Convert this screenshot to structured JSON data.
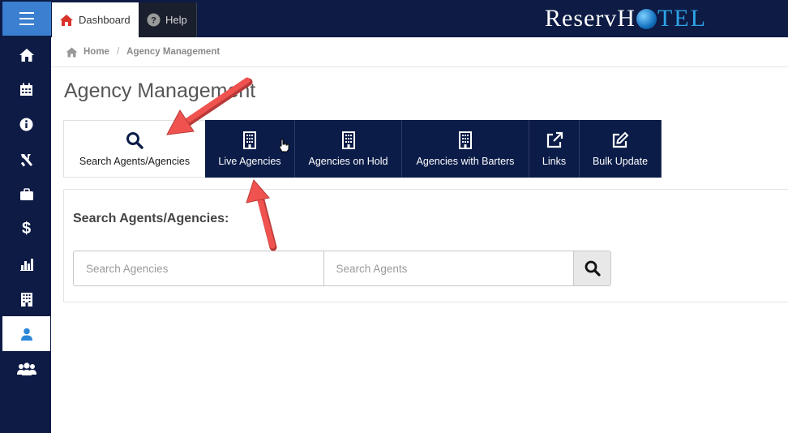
{
  "topbar": {
    "menu_icon": "hamburger-icon",
    "tabs": [
      {
        "label": "Dashboard",
        "icon": "home-icon"
      },
      {
        "label": "Help",
        "icon": "question-circle-icon"
      }
    ],
    "brand": {
      "part1": "ReservH",
      "part2": "TEL"
    }
  },
  "sidebar": {
    "items": [
      {
        "icon": "home-icon"
      },
      {
        "icon": "calendar-icon"
      },
      {
        "icon": "info-icon"
      },
      {
        "icon": "tools-icon"
      },
      {
        "icon": "briefcase-icon"
      },
      {
        "icon": "dollar-icon"
      },
      {
        "icon": "bar-chart-icon"
      },
      {
        "icon": "building-icon"
      },
      {
        "icon": "user-icon",
        "active": true
      },
      {
        "icon": "users-icon"
      }
    ]
  },
  "breadcrumb": {
    "home": "Home",
    "current": "Agency Management"
  },
  "page": {
    "title": "Agency Management"
  },
  "tabs": [
    {
      "label": "Search Agents/Agencies",
      "icon": "search-icon",
      "active": true
    },
    {
      "label": "Live Agencies",
      "icon": "building-icon"
    },
    {
      "label": "Agencies on Hold",
      "icon": "building-icon"
    },
    {
      "label": "Agencies with Barters",
      "icon": "building-icon"
    },
    {
      "label": "Links",
      "icon": "external-link-icon"
    },
    {
      "label": "Bulk Update",
      "icon": "edit-icon"
    }
  ],
  "search": {
    "title": "Search Agents/Agencies:",
    "agencies_placeholder": "Search Agencies",
    "agents_placeholder": "Search Agents",
    "agencies_value": "",
    "agents_value": ""
  },
  "colors": {
    "navy": "#0d1b45",
    "accent": "#3a7fd0",
    "arrow": "#ef5350",
    "brand_blue": "#2ea3e6"
  }
}
